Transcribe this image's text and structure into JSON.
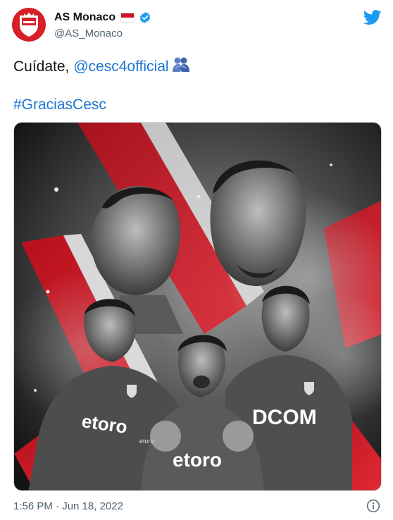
{
  "author": {
    "display_name": "AS Monaco",
    "handle": "@AS_Monaco",
    "avatar_icon": "as-monaco-crest-icon",
    "flag_icon": "monaco-flag-icon",
    "verified_icon": "verified-badge-icon"
  },
  "tweet": {
    "text_prefix": "Cuídate, ",
    "mention": "@cesc4official",
    "emoji": "people-hugging-emoji",
    "hashtag": "#GraciasCesc"
  },
  "media": {
    "jersey_text_1": "etoro",
    "jersey_text_2": "etoro",
    "jersey_text_3": "etoro",
    "jersey_text_4": "DCOM"
  },
  "footer": {
    "timestamp": "1:56 PM · Jun 18, 2022",
    "info_icon": "info-icon"
  },
  "colors": {
    "link": "#1b76d2",
    "twitter_blue": "#1d9bf0",
    "monaco_red": "#d61f26"
  }
}
